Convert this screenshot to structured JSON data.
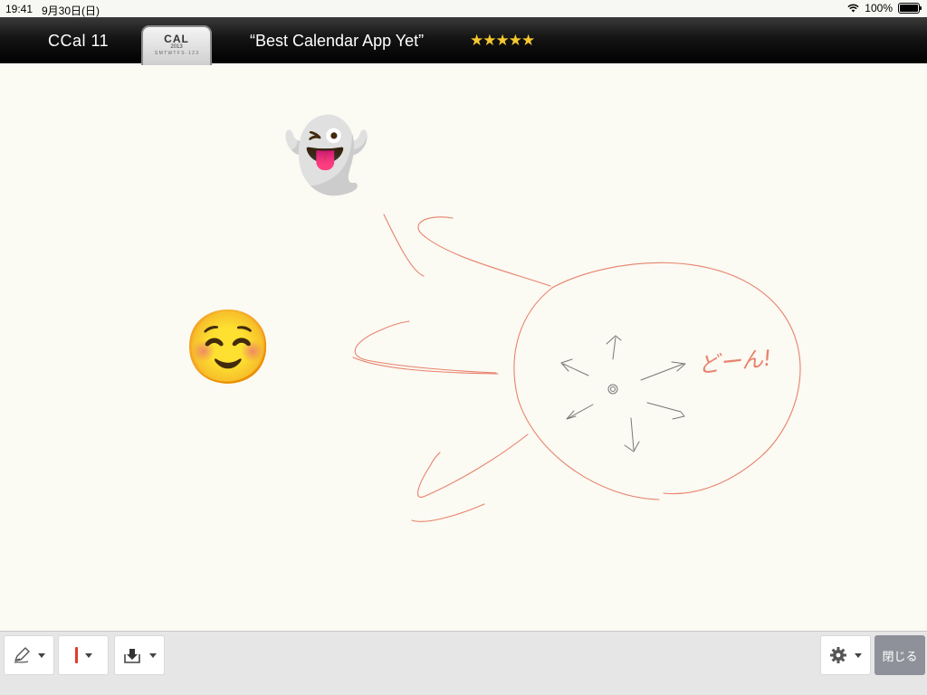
{
  "status_bar": {
    "time": "19:41",
    "date": "9月30日(日)",
    "battery": "100%"
  },
  "ad_banner": {
    "app_name": "CCal 11",
    "icon_label": "CAL",
    "icon_year": "2013",
    "icon_grid": "S M T W T F S · 1 2 3",
    "tagline": "“Best Calendar App Yet”",
    "stars": "★★★★★",
    "rating": 5
  },
  "canvas": {
    "stickers": [
      "ghost-emoji",
      "smiling-face-emoji"
    ],
    "ghost": "👻",
    "smile": "☺️",
    "handwriting": "どーん!",
    "ink_color": "#e8826c",
    "pencil_color": "#777777"
  },
  "toolbar": {
    "pen_icon": "pencil-icon",
    "color_value": "#e33a2a",
    "save_icon": "download-tray-icon",
    "settings_icon": "gear-icon",
    "close_label": "閉じる"
  }
}
